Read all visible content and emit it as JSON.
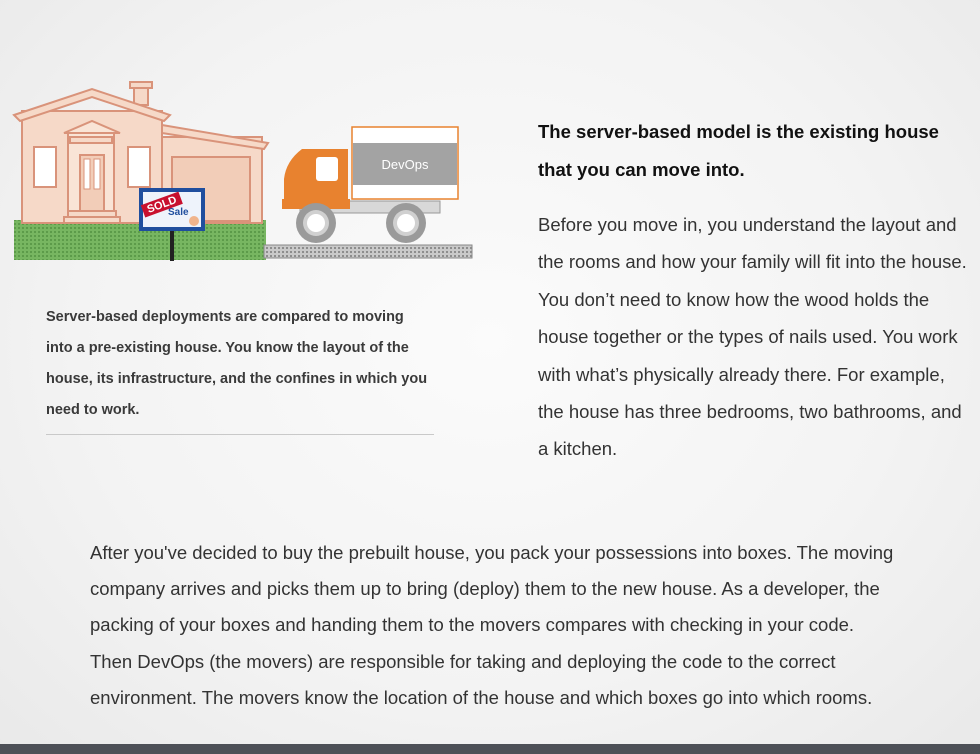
{
  "illustration": {
    "sign_sold": "SOLD",
    "sign_sale": "Sale",
    "truck_label": "DevOps"
  },
  "caption": {
    "text": "Server-based deployments are compared to moving into a pre-existing house. You know the layout of the house, its infrastructure, and the confines in which you need to work."
  },
  "right": {
    "heading": "The server-based model is the existing house that you can move into.",
    "body": "Before you move in, you understand the layout and the rooms and how your family will fit into the house. You don’t need to know how the wood holds the house together or the types of nails used. You work with what’s physically already there. For example, the house has three bedrooms, two bathrooms, and a kitchen."
  },
  "bottom": {
    "body": "After you've decided to buy the prebuilt house, you pack your possessions into boxes. The moving company arrives and picks them up to bring (deploy) them to the new house. As a developer, the packing of your boxes and handing them to the movers compares with checking in your code. Then DevOps (the movers) are responsible for taking and deploying the code to the correct environment. The movers know the location of the house and which boxes go into which rooms."
  },
  "colors": {
    "house_fill": "#f6d9c8",
    "house_stroke": "#d9937a",
    "truck_orange": "#e8822f",
    "truck_box": "#a3a3a3",
    "grass": "#6fae5a",
    "sign_red": "#c8102e",
    "sign_blue": "#1f4e9e",
    "bottom_bar": "#4d5057"
  }
}
